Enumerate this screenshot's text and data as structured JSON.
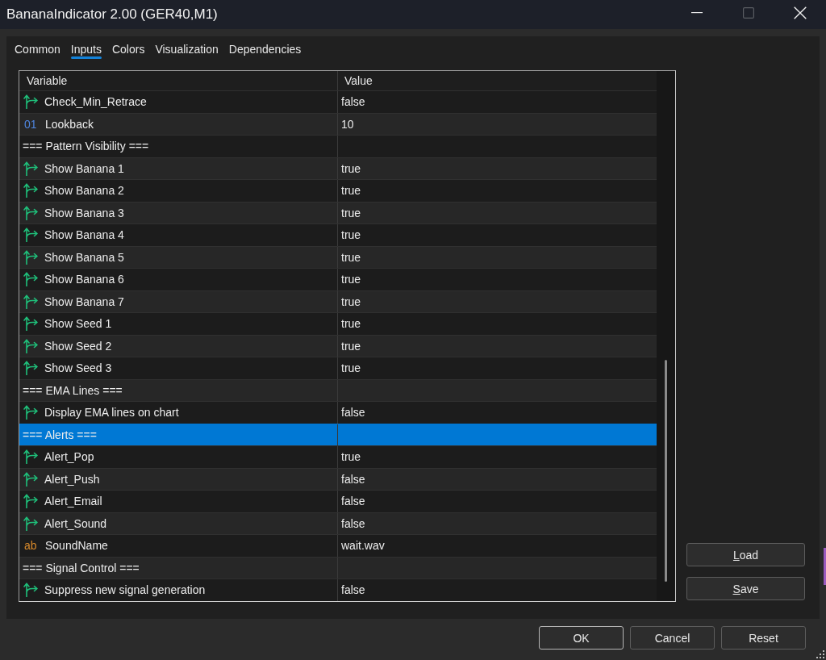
{
  "window": {
    "title": "BananaIndicator 2.00 (GER40,M1)"
  },
  "tabs": [
    {
      "label": "Common",
      "selected": false
    },
    {
      "label": "Inputs",
      "selected": true
    },
    {
      "label": "Colors",
      "selected": false
    },
    {
      "label": "Visualization",
      "selected": false
    },
    {
      "label": "Dependencies",
      "selected": false
    }
  ],
  "table": {
    "columns": [
      "Variable",
      "Value"
    ],
    "rows": [
      {
        "kind": "bool",
        "variable": "Check_Min_Retrace",
        "value": "false",
        "selected": false
      },
      {
        "kind": "int",
        "icon_text": "01",
        "variable": "Lookback",
        "value": "10",
        "selected": false
      },
      {
        "kind": "section",
        "variable": "=== Pattern Visibility ===",
        "selected": false
      },
      {
        "kind": "bool",
        "variable": "Show Banana 1",
        "value": "true",
        "selected": false
      },
      {
        "kind": "bool",
        "variable": "Show Banana 2",
        "value": "true",
        "selected": false
      },
      {
        "kind": "bool",
        "variable": "Show Banana 3",
        "value": "true",
        "selected": false
      },
      {
        "kind": "bool",
        "variable": "Show Banana 4",
        "value": "true",
        "selected": false
      },
      {
        "kind": "bool",
        "variable": "Show Banana 5",
        "value": "true",
        "selected": false
      },
      {
        "kind": "bool",
        "variable": "Show Banana 6",
        "value": "true",
        "selected": false
      },
      {
        "kind": "bool",
        "variable": "Show Banana 7",
        "value": "true",
        "selected": false
      },
      {
        "kind": "bool",
        "variable": "Show Seed 1",
        "value": "true",
        "selected": false
      },
      {
        "kind": "bool",
        "variable": "Show Seed 2",
        "value": "true",
        "selected": false
      },
      {
        "kind": "bool",
        "variable": "Show Seed 3",
        "value": "true",
        "selected": false
      },
      {
        "kind": "section",
        "variable": "=== EMA Lines ===",
        "selected": false
      },
      {
        "kind": "bool",
        "variable": "Display EMA lines on chart",
        "value": "false",
        "selected": false
      },
      {
        "kind": "section",
        "variable": "=== Alerts ===",
        "selected": true
      },
      {
        "kind": "bool",
        "variable": "Alert_Pop",
        "value": "true",
        "selected": false
      },
      {
        "kind": "bool",
        "variable": "Alert_Push",
        "value": "false",
        "selected": false
      },
      {
        "kind": "bool",
        "variable": "Alert_Email",
        "value": "false",
        "selected": false
      },
      {
        "kind": "bool",
        "variable": "Alert_Sound",
        "value": "false",
        "selected": false
      },
      {
        "kind": "string",
        "icon_text": "ab",
        "variable": "SoundName",
        "value": "wait.wav",
        "selected": false
      },
      {
        "kind": "section",
        "variable": "=== Signal Control ===",
        "selected": false
      },
      {
        "kind": "bool",
        "variable": "Suppress new signal generation",
        "value": "false",
        "selected": false
      }
    ]
  },
  "side_buttons": [
    {
      "label": "Load",
      "mnemonic": true
    },
    {
      "label": "Save",
      "mnemonic": true
    }
  ],
  "buttons": [
    {
      "label": "OK",
      "default": true
    },
    {
      "label": "Cancel",
      "default": false
    },
    {
      "label": "Reset",
      "default": false
    }
  ]
}
